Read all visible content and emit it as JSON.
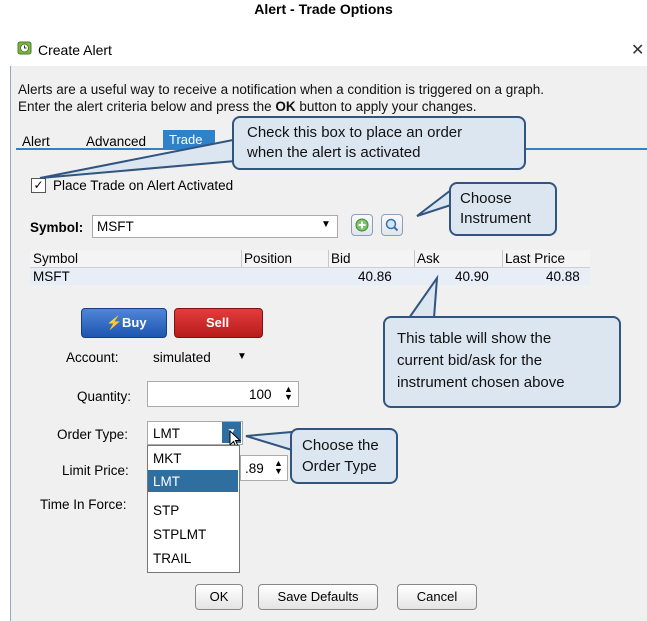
{
  "page_title": "Alert - Trade Options",
  "window": {
    "title": "Create Alert",
    "close_icon": "close-icon",
    "app_icon": "clock-alert-icon"
  },
  "description": {
    "line1": "Alerts are a useful way to receive a notification when a condition is triggered on a graph.",
    "line2_prefix": "Enter the alert criteria below and press the ",
    "line2_bold": "OK",
    "line2_suffix": " button to apply your changes."
  },
  "tabs": [
    {
      "label": "Alert",
      "active": false
    },
    {
      "label": "Advanced",
      "active": false
    },
    {
      "label": "Trade",
      "active": true
    }
  ],
  "place_trade": {
    "checked": true,
    "check_mark": "✓",
    "label": "Place Trade on Alert Activated"
  },
  "symbol": {
    "label": "Symbol:",
    "value": "MSFT",
    "add_icon": "add-icon",
    "search_icon": "search-icon"
  },
  "grid": {
    "columns": [
      "Symbol",
      "Position",
      "Bid",
      "Ask",
      "Last Price"
    ],
    "rows": [
      {
        "symbol": "MSFT",
        "position": "",
        "bid": "40.86",
        "ask": "40.90",
        "last": "40.88"
      }
    ]
  },
  "buttons": {
    "buy": "Buy",
    "sell": "Sell",
    "ok": "OK",
    "save_defaults": "Save Defaults",
    "cancel": "Cancel"
  },
  "form": {
    "account_label": "Account:",
    "account_value": "simulated",
    "quantity_label": "Quantity:",
    "quantity_value": "100",
    "order_type_label": "Order Type:",
    "order_type_value": "LMT",
    "limit_price_label": "Limit Price:",
    "limit_price_value": ".89",
    "tif_label": "Time In Force:"
  },
  "order_type_options": [
    "MKT",
    "LMT",
    "STP",
    "STPLMT",
    "TRAIL"
  ],
  "order_type_selected": "LMT",
  "callouts": {
    "checkbox": {
      "line1": "Check this box to place an order",
      "line2": "when the alert is activated"
    },
    "instrument": {
      "line1": "Choose",
      "line2": "Instrument"
    },
    "table": {
      "line1": "This table will show the",
      "line2": "current bid/ask for the",
      "line3": "instrument chosen above"
    },
    "order_type": {
      "line1": "Choose the",
      "line2": "Order Type"
    }
  },
  "colors": {
    "accent": "#2f82c8",
    "callout_bg": "#dbe6f1",
    "callout_border": "#31557f",
    "buy": "#1d56b0",
    "sell": "#c62222"
  }
}
